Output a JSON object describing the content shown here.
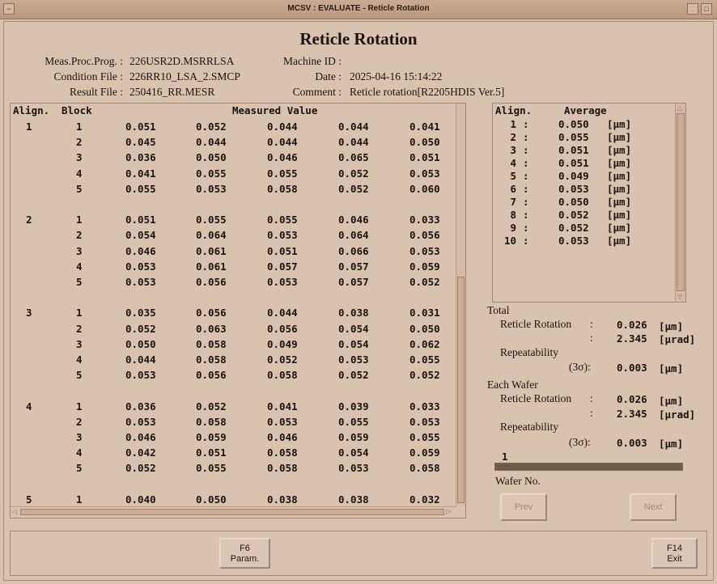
{
  "window": {
    "title": "MCSV : EVALUATE - Reticle Rotation"
  },
  "page": {
    "heading": "Reticle Rotation"
  },
  "info": {
    "meas_proc_prog_label": "Meas.Proc.Prog. :",
    "meas_proc_prog": "226USR2D.MSRRLSA",
    "condition_file_label": "Condition File :",
    "condition_file": "226RR10_LSA_2.SMCP",
    "result_file_label": "Result File :",
    "result_file": "250416_RR.MESR",
    "machine_id_label": "Machine ID :",
    "machine_id": "",
    "date_label": "Date :",
    "date": "2025-04-16 15:14:22",
    "comment_label": "Comment :",
    "comment": "Reticle rotation[R2205HDIS Ver.5]"
  },
  "table": {
    "headers": {
      "align": "Align.",
      "block": "Block",
      "measured": "Measured Value"
    },
    "groups": [
      {
        "align": "1",
        "rows": [
          {
            "block": "1",
            "values": [
              "0.051",
              "0.052",
              "0.044",
              "0.044",
              "0.041"
            ]
          },
          {
            "block": "2",
            "values": [
              "0.045",
              "0.044",
              "0.044",
              "0.044",
              "0.050"
            ]
          },
          {
            "block": "3",
            "values": [
              "0.036",
              "0.050",
              "0.046",
              "0.065",
              "0.051"
            ]
          },
          {
            "block": "4",
            "values": [
              "0.041",
              "0.055",
              "0.055",
              "0.052",
              "0.053"
            ]
          },
          {
            "block": "5",
            "values": [
              "0.055",
              "0.053",
              "0.058",
              "0.052",
              "0.060"
            ]
          }
        ]
      },
      {
        "align": "2",
        "rows": [
          {
            "block": "1",
            "values": [
              "0.051",
              "0.055",
              "0.055",
              "0.046",
              "0.033"
            ]
          },
          {
            "block": "2",
            "values": [
              "0.054",
              "0.064",
              "0.053",
              "0.064",
              "0.056"
            ]
          },
          {
            "block": "3",
            "values": [
              "0.046",
              "0.061",
              "0.051",
              "0.066",
              "0.053"
            ]
          },
          {
            "block": "4",
            "values": [
              "0.053",
              "0.061",
              "0.057",
              "0.057",
              "0.059"
            ]
          },
          {
            "block": "5",
            "values": [
              "0.053",
              "0.056",
              "0.053",
              "0.057",
              "0.052"
            ]
          }
        ]
      },
      {
        "align": "3",
        "rows": [
          {
            "block": "1",
            "values": [
              "0.035",
              "0.056",
              "0.044",
              "0.038",
              "0.031"
            ]
          },
          {
            "block": "2",
            "values": [
              "0.052",
              "0.063",
              "0.056",
              "0.054",
              "0.050"
            ]
          },
          {
            "block": "3",
            "values": [
              "0.050",
              "0.058",
              "0.049",
              "0.054",
              "0.062"
            ]
          },
          {
            "block": "4",
            "values": [
              "0.044",
              "0.058",
              "0.052",
              "0.053",
              "0.055"
            ]
          },
          {
            "block": "5",
            "values": [
              "0.053",
              "0.056",
              "0.058",
              "0.052",
              "0.052"
            ]
          }
        ]
      },
      {
        "align": "4",
        "rows": [
          {
            "block": "1",
            "values": [
              "0.036",
              "0.052",
              "0.041",
              "0.039",
              "0.033"
            ]
          },
          {
            "block": "2",
            "values": [
              "0.053",
              "0.058",
              "0.053",
              "0.055",
              "0.053"
            ]
          },
          {
            "block": "3",
            "values": [
              "0.046",
              "0.059",
              "0.046",
              "0.059",
              "0.055"
            ]
          },
          {
            "block": "4",
            "values": [
              "0.042",
              "0.051",
              "0.058",
              "0.054",
              "0.059"
            ]
          },
          {
            "block": "5",
            "values": [
              "0.052",
              "0.055",
              "0.058",
              "0.053",
              "0.058"
            ]
          }
        ]
      },
      {
        "align": "5",
        "rows": [
          {
            "block": "1",
            "values": [
              "0.040",
              "0.050",
              "0.038",
              "0.038",
              "0.032"
            ]
          }
        ]
      }
    ]
  },
  "average": {
    "headers": {
      "align": "Align.",
      "average": "Average"
    },
    "rows": [
      {
        "align": "1",
        "value": "0.050",
        "unit": "[µm]"
      },
      {
        "align": "2",
        "value": "0.055",
        "unit": "[µm]"
      },
      {
        "align": "3",
        "value": "0.051",
        "unit": "[µm]"
      },
      {
        "align": "4",
        "value": "0.051",
        "unit": "[µm]"
      },
      {
        "align": "5",
        "value": "0.049",
        "unit": "[µm]"
      },
      {
        "align": "6",
        "value": "0.053",
        "unit": "[µm]"
      },
      {
        "align": "7",
        "value": "0.050",
        "unit": "[µm]"
      },
      {
        "align": "8",
        "value": "0.052",
        "unit": "[µm]"
      },
      {
        "align": "9",
        "value": "0.052",
        "unit": "[µm]"
      },
      {
        "align": "10",
        "value": "0.053",
        "unit": "[µm]"
      }
    ]
  },
  "total": {
    "label": "Total",
    "rotation_label": "Reticle Rotation",
    "rotation_um": "0.026",
    "rotation_um_unit": "[µm]",
    "rotation_urad": "2.345",
    "rotation_urad_unit": "[µrad]",
    "repeat_label": "Repeatability",
    "sigma_label": "(3σ):",
    "repeat_value": "0.003",
    "repeat_unit": "[µm]"
  },
  "each_wafer": {
    "label": "Each Wafer",
    "rotation_label": "Reticle Rotation",
    "rotation_um": "0.026",
    "rotation_um_unit": "[µm]",
    "rotation_urad": "2.345",
    "rotation_urad_unit": "[µrad]",
    "repeat_label": "Repeatability",
    "sigma_label": "(3σ):",
    "repeat_value": "0.003",
    "repeat_unit": "[µm]"
  },
  "wafer": {
    "current": "1",
    "label": "Wafer No.",
    "progress_fraction": 1.0
  },
  "buttons": {
    "prev": "Prev",
    "next": "Next",
    "f6_key": "F6",
    "f6_label": "Param.",
    "f14_key": "F14",
    "f14_label": "Exit"
  },
  "colors": {
    "background": "#d9c2ae",
    "progress_fill": "#6c5c45"
  }
}
